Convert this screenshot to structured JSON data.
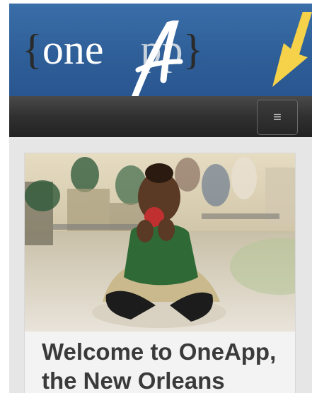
{
  "header": {
    "logo": {
      "brace_open": "{",
      "one": "one",
      "a_letter": "A",
      "pp": "pp",
      "brace_close": "}",
      "alt": "oneApp"
    },
    "arrow_color": "#f5d24a",
    "background": "#2f5f98"
  },
  "navbar": {
    "menu_button_label": "≡",
    "menu_icon": "hamburger-icon",
    "background": "#303030"
  },
  "hero": {
    "image_alt": "Child sitting on cafeteria floor eating a red apple",
    "heading": "Welcome to OneApp, the New Orleans"
  }
}
